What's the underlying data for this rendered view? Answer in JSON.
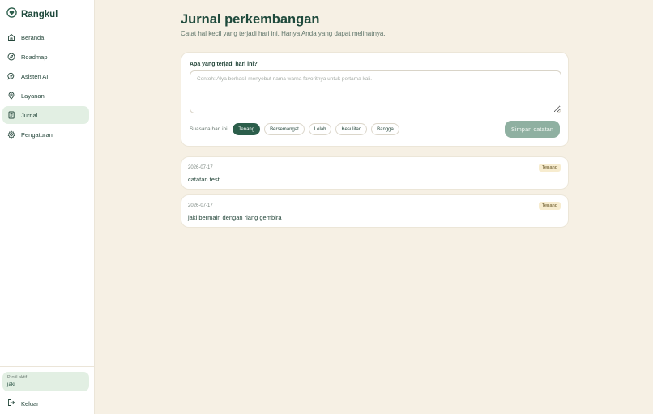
{
  "brand": {
    "name": "Rangkul"
  },
  "sidebar": {
    "items": [
      {
        "label": "Beranda",
        "icon": "home-icon",
        "active": false
      },
      {
        "label": "Roadmap",
        "icon": "compass-icon",
        "active": false
      },
      {
        "label": "Asisten AI",
        "icon": "chat-icon",
        "active": false
      },
      {
        "label": "Layanan",
        "icon": "location-pin-icon",
        "active": false
      },
      {
        "label": "Jurnal",
        "icon": "notebook-icon",
        "active": true
      },
      {
        "label": "Pengaturan",
        "icon": "gear-icon",
        "active": false
      }
    ],
    "profile": {
      "label": "Profil aktif",
      "name": "jaki"
    },
    "logout_label": "Keluar"
  },
  "page": {
    "title": "Jurnal perkembangan",
    "subtitle": "Catat hal kecil yang terjadi hari ini. Hanya Anda yang dapat melihatnya."
  },
  "composer": {
    "question": "Apa yang terjadi hari ini?",
    "placeholder": "Contoh: Alya berhasil menyebut nama warna favoritnya untuk pertama kali.",
    "value": "",
    "mood_label": "Suasana hari ini:",
    "moods": [
      "Tenang",
      "Bersemangat",
      "Lelah",
      "Kesulitan",
      "Bangga"
    ],
    "selected_mood": "Tenang",
    "save_label": "Simpan catatan"
  },
  "entries": [
    {
      "date": "2026-07-17",
      "text": "catatan test",
      "mood": "Tenang"
    },
    {
      "date": "2026-07-17",
      "text": "jaki bermain dengan riang gembira",
      "mood": "Tenang"
    }
  ],
  "colors": {
    "background": "#f6f0e4",
    "brand": "#1f4a3c",
    "accent": "#2c5e4b",
    "active_nav": "#e2efe3",
    "save_button": "#8fb0a1",
    "badge": "#f7eccf"
  }
}
